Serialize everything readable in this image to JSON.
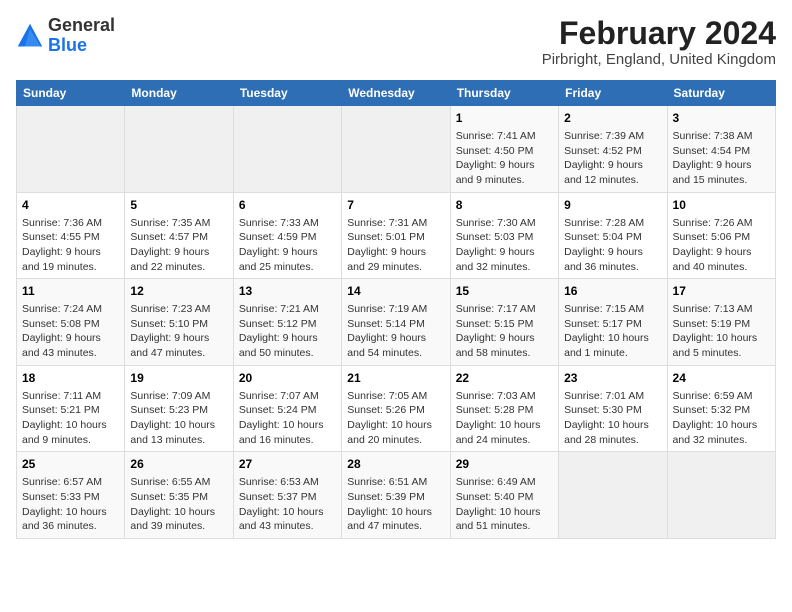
{
  "header": {
    "logo_general": "General",
    "logo_blue": "Blue",
    "title": "February 2024",
    "subtitle": "Pirbright, England, United Kingdom"
  },
  "weekdays": [
    "Sunday",
    "Monday",
    "Tuesday",
    "Wednesday",
    "Thursday",
    "Friday",
    "Saturday"
  ],
  "weeks": [
    [
      {
        "day": "",
        "info": ""
      },
      {
        "day": "",
        "info": ""
      },
      {
        "day": "",
        "info": ""
      },
      {
        "day": "",
        "info": ""
      },
      {
        "day": "1",
        "info": "Sunrise: 7:41 AM\nSunset: 4:50 PM\nDaylight: 9 hours and 9 minutes."
      },
      {
        "day": "2",
        "info": "Sunrise: 7:39 AM\nSunset: 4:52 PM\nDaylight: 9 hours and 12 minutes."
      },
      {
        "day": "3",
        "info": "Sunrise: 7:38 AM\nSunset: 4:54 PM\nDaylight: 9 hours and 15 minutes."
      }
    ],
    [
      {
        "day": "4",
        "info": "Sunrise: 7:36 AM\nSunset: 4:55 PM\nDaylight: 9 hours and 19 minutes."
      },
      {
        "day": "5",
        "info": "Sunrise: 7:35 AM\nSunset: 4:57 PM\nDaylight: 9 hours and 22 minutes."
      },
      {
        "day": "6",
        "info": "Sunrise: 7:33 AM\nSunset: 4:59 PM\nDaylight: 9 hours and 25 minutes."
      },
      {
        "day": "7",
        "info": "Sunrise: 7:31 AM\nSunset: 5:01 PM\nDaylight: 9 hours and 29 minutes."
      },
      {
        "day": "8",
        "info": "Sunrise: 7:30 AM\nSunset: 5:03 PM\nDaylight: 9 hours and 32 minutes."
      },
      {
        "day": "9",
        "info": "Sunrise: 7:28 AM\nSunset: 5:04 PM\nDaylight: 9 hours and 36 minutes."
      },
      {
        "day": "10",
        "info": "Sunrise: 7:26 AM\nSunset: 5:06 PM\nDaylight: 9 hours and 40 minutes."
      }
    ],
    [
      {
        "day": "11",
        "info": "Sunrise: 7:24 AM\nSunset: 5:08 PM\nDaylight: 9 hours and 43 minutes."
      },
      {
        "day": "12",
        "info": "Sunrise: 7:23 AM\nSunset: 5:10 PM\nDaylight: 9 hours and 47 minutes."
      },
      {
        "day": "13",
        "info": "Sunrise: 7:21 AM\nSunset: 5:12 PM\nDaylight: 9 hours and 50 minutes."
      },
      {
        "day": "14",
        "info": "Sunrise: 7:19 AM\nSunset: 5:14 PM\nDaylight: 9 hours and 54 minutes."
      },
      {
        "day": "15",
        "info": "Sunrise: 7:17 AM\nSunset: 5:15 PM\nDaylight: 9 hours and 58 minutes."
      },
      {
        "day": "16",
        "info": "Sunrise: 7:15 AM\nSunset: 5:17 PM\nDaylight: 10 hours and 1 minute."
      },
      {
        "day": "17",
        "info": "Sunrise: 7:13 AM\nSunset: 5:19 PM\nDaylight: 10 hours and 5 minutes."
      }
    ],
    [
      {
        "day": "18",
        "info": "Sunrise: 7:11 AM\nSunset: 5:21 PM\nDaylight: 10 hours and 9 minutes."
      },
      {
        "day": "19",
        "info": "Sunrise: 7:09 AM\nSunset: 5:23 PM\nDaylight: 10 hours and 13 minutes."
      },
      {
        "day": "20",
        "info": "Sunrise: 7:07 AM\nSunset: 5:24 PM\nDaylight: 10 hours and 16 minutes."
      },
      {
        "day": "21",
        "info": "Sunrise: 7:05 AM\nSunset: 5:26 PM\nDaylight: 10 hours and 20 minutes."
      },
      {
        "day": "22",
        "info": "Sunrise: 7:03 AM\nSunset: 5:28 PM\nDaylight: 10 hours and 24 minutes."
      },
      {
        "day": "23",
        "info": "Sunrise: 7:01 AM\nSunset: 5:30 PM\nDaylight: 10 hours and 28 minutes."
      },
      {
        "day": "24",
        "info": "Sunrise: 6:59 AM\nSunset: 5:32 PM\nDaylight: 10 hours and 32 minutes."
      }
    ],
    [
      {
        "day": "25",
        "info": "Sunrise: 6:57 AM\nSunset: 5:33 PM\nDaylight: 10 hours and 36 minutes."
      },
      {
        "day": "26",
        "info": "Sunrise: 6:55 AM\nSunset: 5:35 PM\nDaylight: 10 hours and 39 minutes."
      },
      {
        "day": "27",
        "info": "Sunrise: 6:53 AM\nSunset: 5:37 PM\nDaylight: 10 hours and 43 minutes."
      },
      {
        "day": "28",
        "info": "Sunrise: 6:51 AM\nSunset: 5:39 PM\nDaylight: 10 hours and 47 minutes."
      },
      {
        "day": "29",
        "info": "Sunrise: 6:49 AM\nSunset: 5:40 PM\nDaylight: 10 hours and 51 minutes."
      },
      {
        "day": "",
        "info": ""
      },
      {
        "day": "",
        "info": ""
      }
    ]
  ]
}
